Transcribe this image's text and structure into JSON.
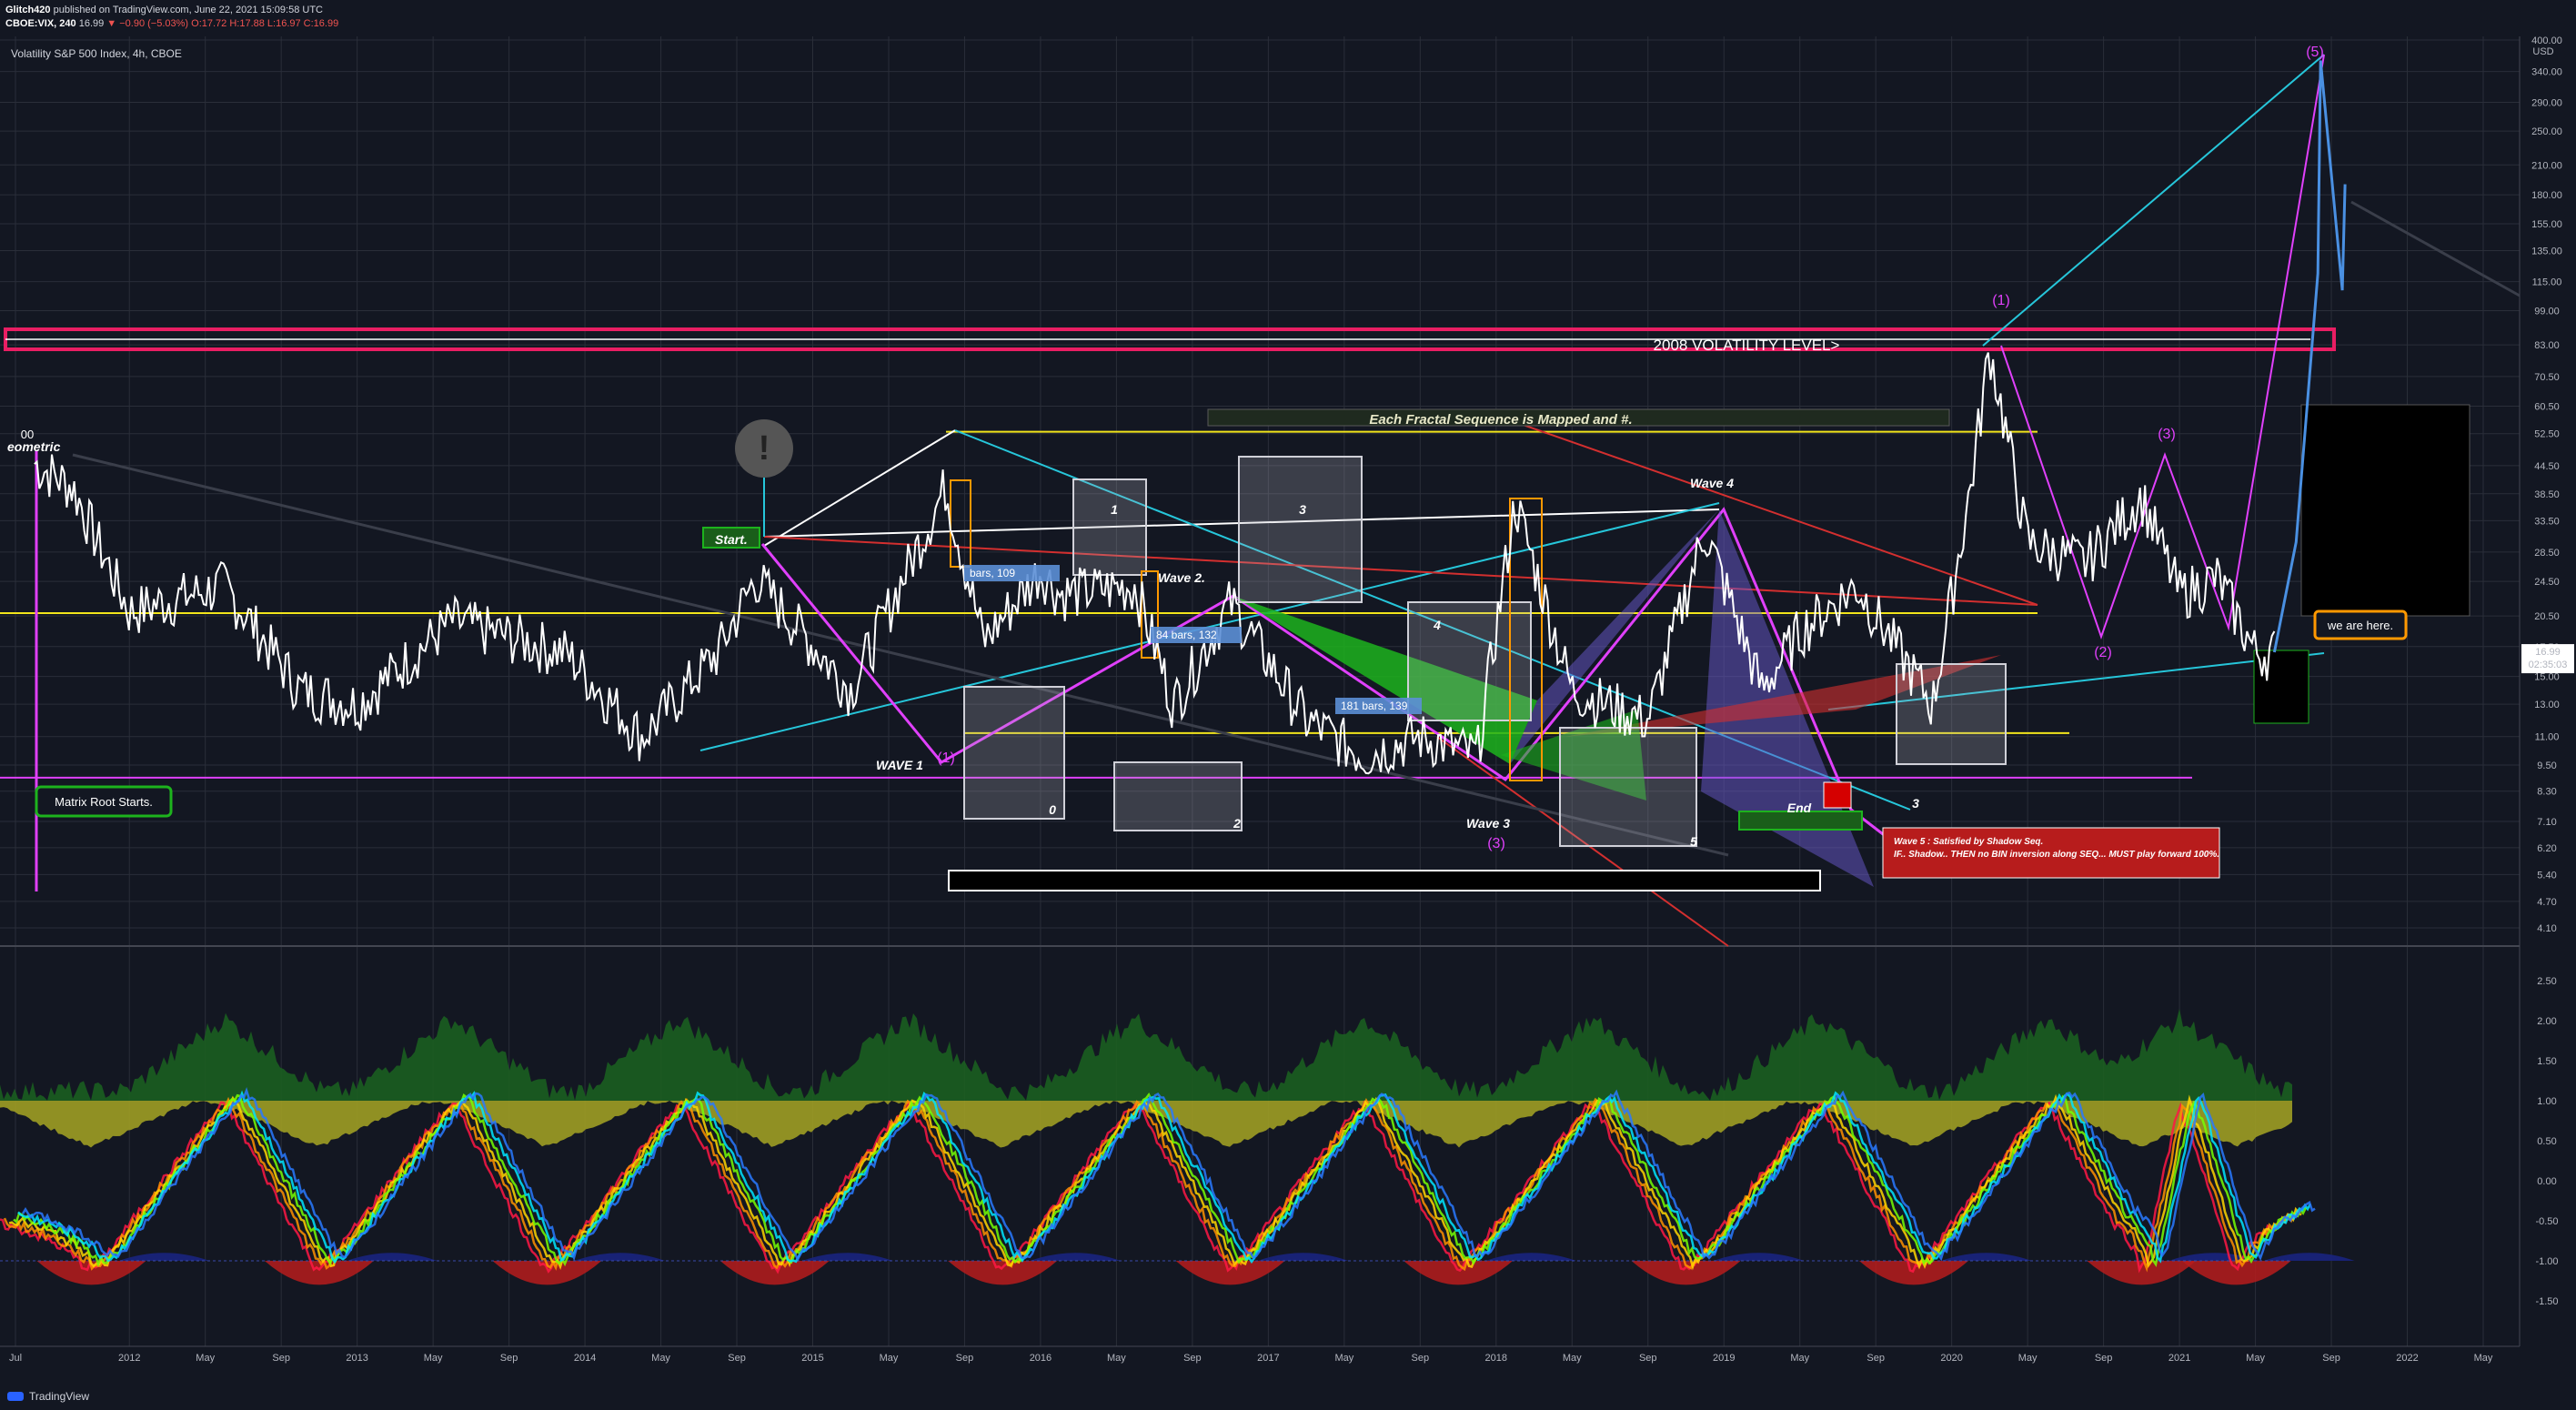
{
  "header": {
    "author": "Glitch420",
    "published": "published on TradingView.com, June 22, 2021 15:09:58 UTC",
    "symbol_line": "CBOE:VIX, 240",
    "last": "16.99",
    "change": "▼ −0.90 (−5.03%)",
    "ohlc": "O:17.72 H:17.88 L:16.97 C:16.99"
  },
  "instrument_title": "Volatility S&P 500 Index, 4h, CBOE",
  "footer": {
    "brand": "TradingView"
  },
  "colors": {
    "background": "#131722",
    "price": "#ffffff",
    "yellow_line": "#f2e51b",
    "magenta": "#e040fb",
    "cyan": "#26c6da",
    "pink_box": "#e91e63",
    "red": "#d32f2f",
    "green": "#2e7d32"
  },
  "chart_data": {
    "type": "line",
    "title": "Volatility S&P 500 Index, 4h, CBOE",
    "y_scale": "log",
    "currency_label": "USD",
    "y_ticks": [
      "400.00",
      "340.00",
      "290.00",
      "250.00",
      "210.00",
      "180.00",
      "155.00",
      "135.00",
      "115.00",
      "99.00",
      "83.00",
      "70.50",
      "60.50",
      "52.50",
      "44.50",
      "38.50",
      "33.50",
      "28.50",
      "24.50",
      "20.50",
      "17.50",
      "15.00",
      "13.00",
      "11.00",
      "9.50",
      "8.30",
      "7.10",
      "6.20",
      "5.40",
      "4.70",
      "4.10"
    ],
    "x_ticks": [
      "Jul",
      "2012",
      "May",
      "Sep",
      "2013",
      "May",
      "Sep",
      "2014",
      "May",
      "Sep",
      "2015",
      "May",
      "Sep",
      "2016",
      "May",
      "Sep",
      "2017",
      "May",
      "Sep",
      "2018",
      "May",
      "Sep",
      "2019",
      "May",
      "Sep",
      "2020",
      "May",
      "Sep",
      "2021",
      "May",
      "Sep",
      "2022",
      "May"
    ],
    "price_label": "16.99",
    "countdown_label": "02:35:03",
    "series": [
      {
        "name": "CBOE:VIX",
        "x": [
          "2011-08",
          "2011-10",
          "2012-01",
          "2012-06",
          "2012-10",
          "2013-01",
          "2013-06",
          "2013-12",
          "2014-04",
          "2014-08",
          "2014-10",
          "2015-03",
          "2015-08",
          "2015-10",
          "2016-01",
          "2016-02",
          "2016-06",
          "2016-08",
          "2016-11",
          "2017-03",
          "2017-06",
          "2017-09",
          "2017-12",
          "2018-02",
          "2018-05",
          "2018-09",
          "2018-12",
          "2019-03",
          "2019-05",
          "2019-08",
          "2019-12",
          "2020-02",
          "2020-03",
          "2020-05",
          "2020-08",
          "2020-11",
          "2021-01",
          "2021-03",
          "2021-05",
          "2021-06"
        ],
        "y": [
          45,
          40,
          21,
          24,
          14,
          13,
          20,
          17,
          11,
          17,
          25,
          14,
          40,
          18,
          26,
          23,
          24,
          13,
          22,
          12,
          10,
          11,
          10,
          37,
          14,
          12,
          32,
          14,
          19,
          24,
          13,
          40,
          82,
          30,
          27,
          38,
          23,
          25,
          17,
          17
        ]
      },
      {
        "name": "Projection",
        "x": [
          "2021-06",
          "2021-07",
          "2021-08",
          "2021-08",
          "2021-09",
          "2021-09"
        ],
        "y": [
          17,
          30,
          120,
          360,
          110,
          190
        ]
      }
    ],
    "annotations": [
      "(5)",
      "(1)",
      "(3)",
      "(2)",
      "(1)",
      "(3)",
      "2008 VOLATILITY LEVEL>",
      "Each Fractal Sequence is Mapped and #.",
      "Start.",
      "WAVE 1",
      "Wave 2.",
      "Wave 3",
      "Wave 4",
      "Wave 5",
      "Matrix Root Starts.",
      "we are here.",
      "1",
      "2",
      "3",
      "4",
      "5",
      "0",
      "3",
      "5",
      "End",
      "Wave 5 : Satisfied by Shadow Seq.",
      "IF.. Shadow.. THEN no BIN inversion along SEQ... MUST play forward 100%.",
      "00",
      "eometric",
      "bars, 109",
      "84 bars, 132",
      "181 bars, 139"
    ],
    "indicator": {
      "y_ticks": [
        "2.50",
        "2.00",
        "1.50",
        "1.00",
        "0.50",
        "0.00",
        "-0.50",
        "-1.00",
        "-1.50"
      ],
      "trough_dates": [
        "2011-11",
        "2012-11",
        "2013-11",
        "2014-11",
        "2015-11",
        "2016-11",
        "2017-11",
        "2018-11",
        "2019-11",
        "2020-11",
        "2021-04"
      ],
      "peak_dates": [
        "2012-06",
        "2013-06",
        "2014-06",
        "2015-06",
        "2016-06",
        "2017-06",
        "2018-06",
        "2019-06",
        "2020-06",
        "2021-01"
      ]
    }
  }
}
